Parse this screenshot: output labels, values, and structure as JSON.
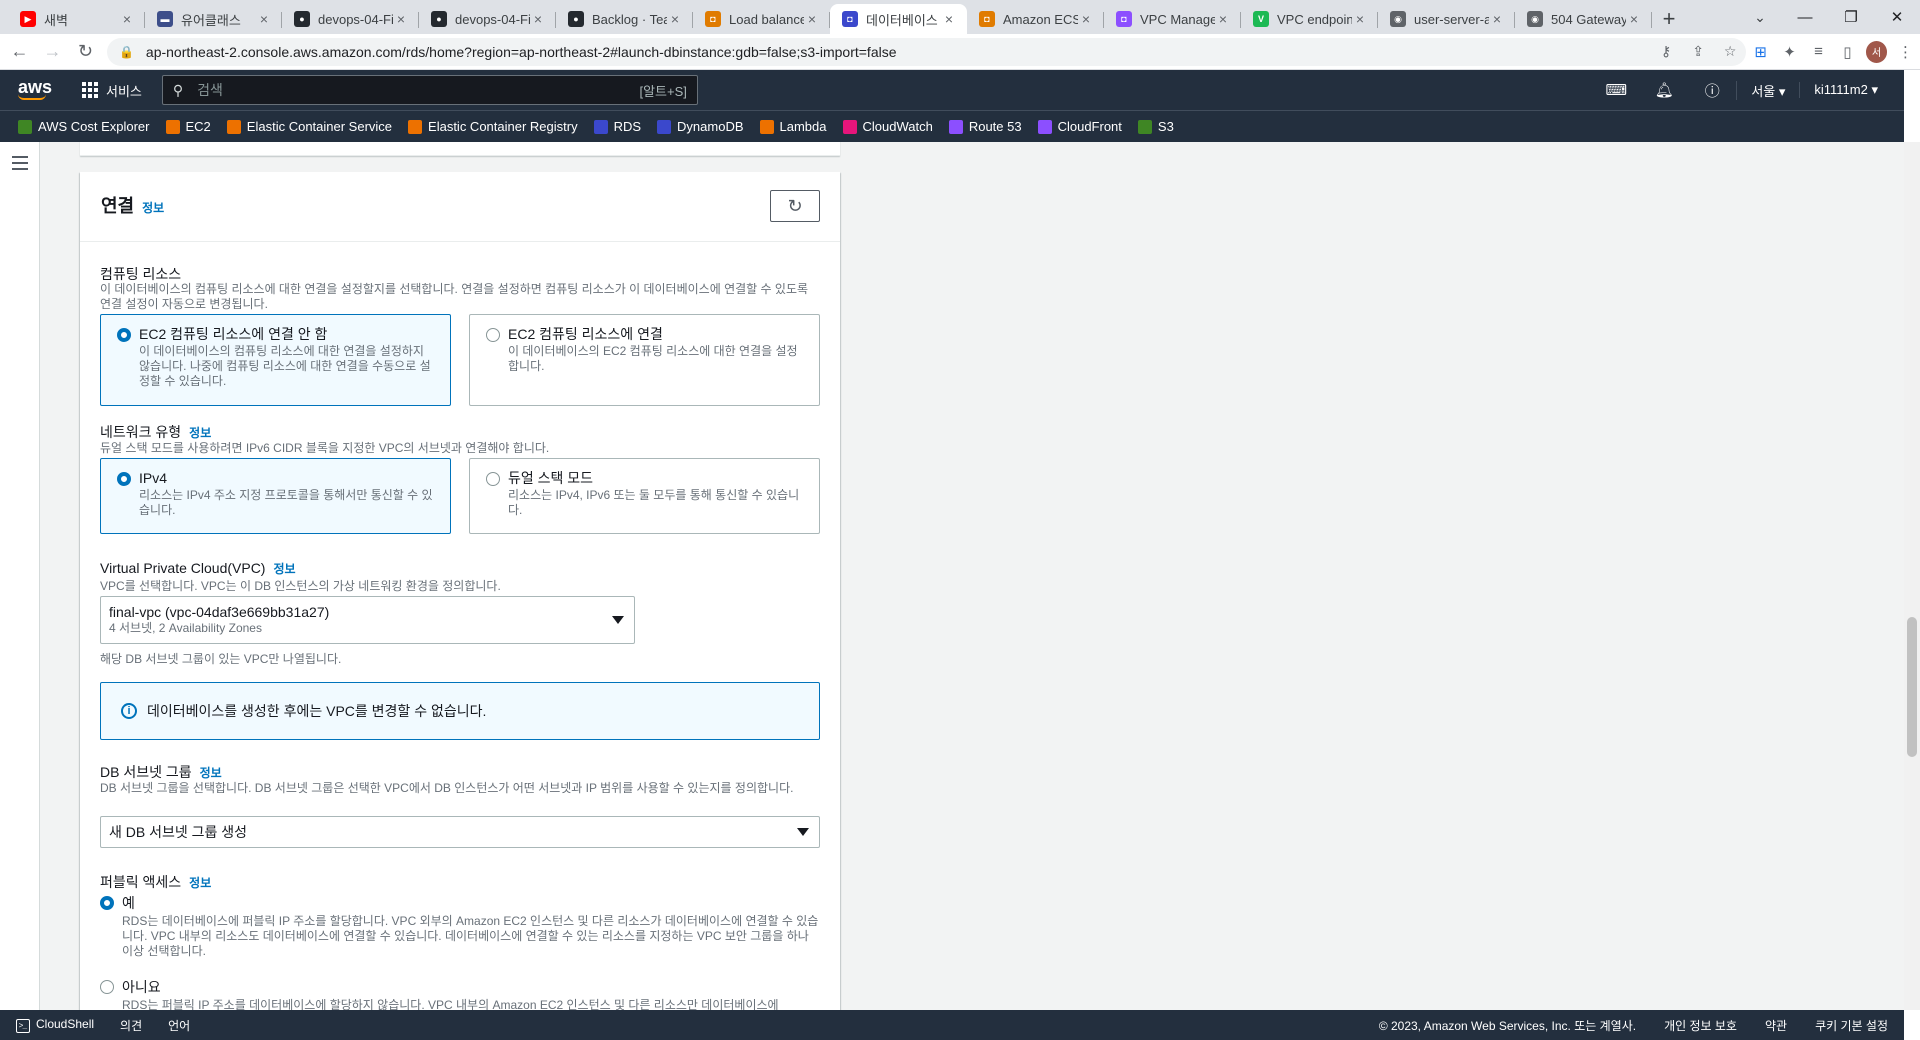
{
  "browser": {
    "tabs": [
      {
        "title": "새벽",
        "color": "#ff0000",
        "glyph": "▶"
      },
      {
        "title": "유어클래스",
        "color": "#3d4e8a",
        "glyph": "▬"
      },
      {
        "title": "devops-04-Fi",
        "color": "#24292f",
        "glyph": "●"
      },
      {
        "title": "devops-04-Fi",
        "color": "#24292f",
        "glyph": "●"
      },
      {
        "title": "Backlog · Tea",
        "color": "#24292f",
        "glyph": "●"
      },
      {
        "title": "Load balance",
        "color": "#e07b00",
        "glyph": "◘"
      },
      {
        "title": "데이터베이스",
        "color": "#3b48cc",
        "glyph": "◘"
      },
      {
        "title": "Amazon ECS",
        "color": "#e07b00",
        "glyph": "◘"
      },
      {
        "title": "VPC Manage",
        "color": "#8c4fff",
        "glyph": "◘"
      },
      {
        "title": "VPC endpoin",
        "color": "#1db954",
        "glyph": "V"
      },
      {
        "title": "user-server-a",
        "color": "#5f6368",
        "glyph": "◉"
      },
      {
        "title": "504 Gateway",
        "color": "#5f6368",
        "glyph": "◉"
      }
    ],
    "active_tab_index": 6,
    "url": "ap-northeast-2.console.aws.amazon.com/rds/home?region=ap-northeast-2#launch-dbinstance:gdb=false;s3-import=false",
    "profile_initial": "서"
  },
  "aws_header": {
    "logo": "aws",
    "services_label": "서비스",
    "search_placeholder": "검색",
    "search_shortcut": "[알트+S]",
    "region": "서울 ▾",
    "user": "ki1111m2 ▾"
  },
  "favorites": [
    {
      "label": "AWS Cost Explorer",
      "color": "#3f8624"
    },
    {
      "label": "EC2",
      "color": "#ed7100"
    },
    {
      "label": "Elastic Container Service",
      "color": "#ed7100"
    },
    {
      "label": "Elastic Container Registry",
      "color": "#ed7100"
    },
    {
      "label": "RDS",
      "color": "#3b48cc"
    },
    {
      "label": "DynamoDB",
      "color": "#3b48cc"
    },
    {
      "label": "Lambda",
      "color": "#ed7100"
    },
    {
      "label": "CloudWatch",
      "color": "#e7157b"
    },
    {
      "label": "Route 53",
      "color": "#8c4fff"
    },
    {
      "label": "CloudFront",
      "color": "#8c4fff"
    },
    {
      "label": "S3",
      "color": "#3f8624"
    }
  ],
  "panel": {
    "title": "연결",
    "info": "정보",
    "compute": {
      "label": "컴퓨팅 리소스",
      "desc": "이 데이터베이스의 컴퓨팅 리소스에 대한 연결을 설정할지를 선택합니다. 연결을 설정하면 컴퓨팅 리소스가 이 데이터베이스에 연결할 수 있도록 연결 설정이 자동으로 변경됩니다.",
      "opt1_title": "EC2 컴퓨팅 리소스에 연결 안 함",
      "opt1_desc": "이 데이터베이스의 컴퓨팅 리소스에 대한 연결을 설정하지 않습니다. 나중에 컴퓨팅 리소스에 대한 연결을 수동으로 설정할 수 있습니다.",
      "opt2_title": "EC2 컴퓨팅 리소스에 연결",
      "opt2_desc": "이 데이터베이스의 EC2 컴퓨팅 리소스에 대한 연결을 설정합니다."
    },
    "network": {
      "label": "네트워크 유형",
      "info": "정보",
      "desc": "듀얼 스택 모드를 사용하려면 IPv6 CIDR 블록을 지정한 VPC의 서브넷과 연결해야 합니다.",
      "opt1_title": "IPv4",
      "opt1_desc": "리소스는 IPv4 주소 지정 프로토콜을 통해서만 통신할 수 있습니다.",
      "opt2_title": "듀얼 스택 모드",
      "opt2_desc": "리소스는 IPv4, IPv6 또는 둘 모두를 통해 통신할 수 있습니다."
    },
    "vpc": {
      "label": "Virtual Private Cloud(VPC)",
      "info": "정보",
      "desc": "VPC를 선택합니다. VPC는 이 DB 인스턴스의 가상 네트워킹 환경을 정의합니다.",
      "value": "final-vpc (vpc-04daf3e669bb31a27)",
      "sub": "4 서브넷, 2 Availability Zones",
      "hint": "해당 DB 서브넷 그룹이 있는 VPC만 나열됩니다."
    },
    "alert": "데이터베이스를 생성한 후에는 VPC를 변경할 수 없습니다.",
    "subnet": {
      "label": "DB 서브넷 그룹",
      "info": "정보",
      "desc": "DB 서브넷 그룹을 선택합니다. DB 서브넷 그룹은 선택한 VPC에서 DB 인스턴스가 어떤 서브넷과 IP 범위를 사용할 수 있는지를 정의합니다.",
      "value": "새 DB 서브넷 그룹 생성"
    },
    "public": {
      "label": "퍼블릭 액세스",
      "info": "정보",
      "yes_title": "예",
      "yes_desc": "RDS는 데이터베이스에 퍼블릭 IP 주소를 할당합니다. VPC 외부의 Amazon EC2 인스턴스 및 다른 리소스가 데이터베이스에 연결할 수 있습니다. VPC 내부의 리소스도 데이터베이스에 연결할 수 있습니다. 데이터베이스에 연결할 수 있는 리소스를 지정하는 VPC 보안 그룹을 하나 이상 선택합니다.",
      "no_title": "아니요",
      "no_desc": "RDS는 퍼블릭 IP 주소를 데이터베이스에 할당하지 않습니다. VPC 내부의 Amazon EC2 인스턴스 및 다른 리소스만 데이터베이스에"
    }
  },
  "footer": {
    "cloudshell": "CloudShell",
    "feedback": "의견",
    "language": "언어",
    "copyright": "© 2023, Amazon Web Services, Inc. 또는 계열사.",
    "privacy": "개인 정보 보호",
    "terms": "약관",
    "cookies": "쿠키 기본 설정"
  }
}
